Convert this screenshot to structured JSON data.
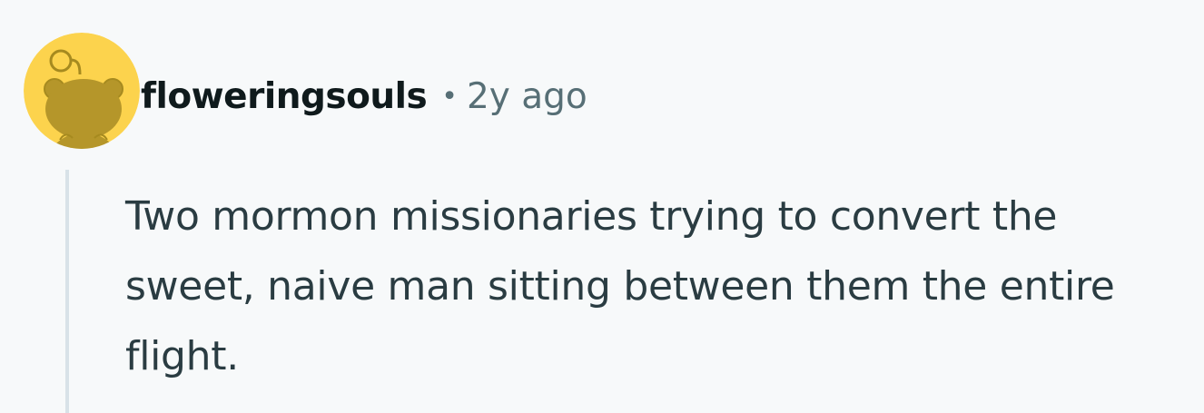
{
  "comment": {
    "author": "floweringsouls",
    "separator": "•",
    "timestamp": "2y ago",
    "body": "Two mormon missionaries trying to convert the sweet, naive man sitting between them the entire flight.",
    "avatar": {
      "icon": "reddit-snoo-avatar",
      "background_color": "#fcd34d",
      "figure_color": "#b5962a"
    }
  }
}
